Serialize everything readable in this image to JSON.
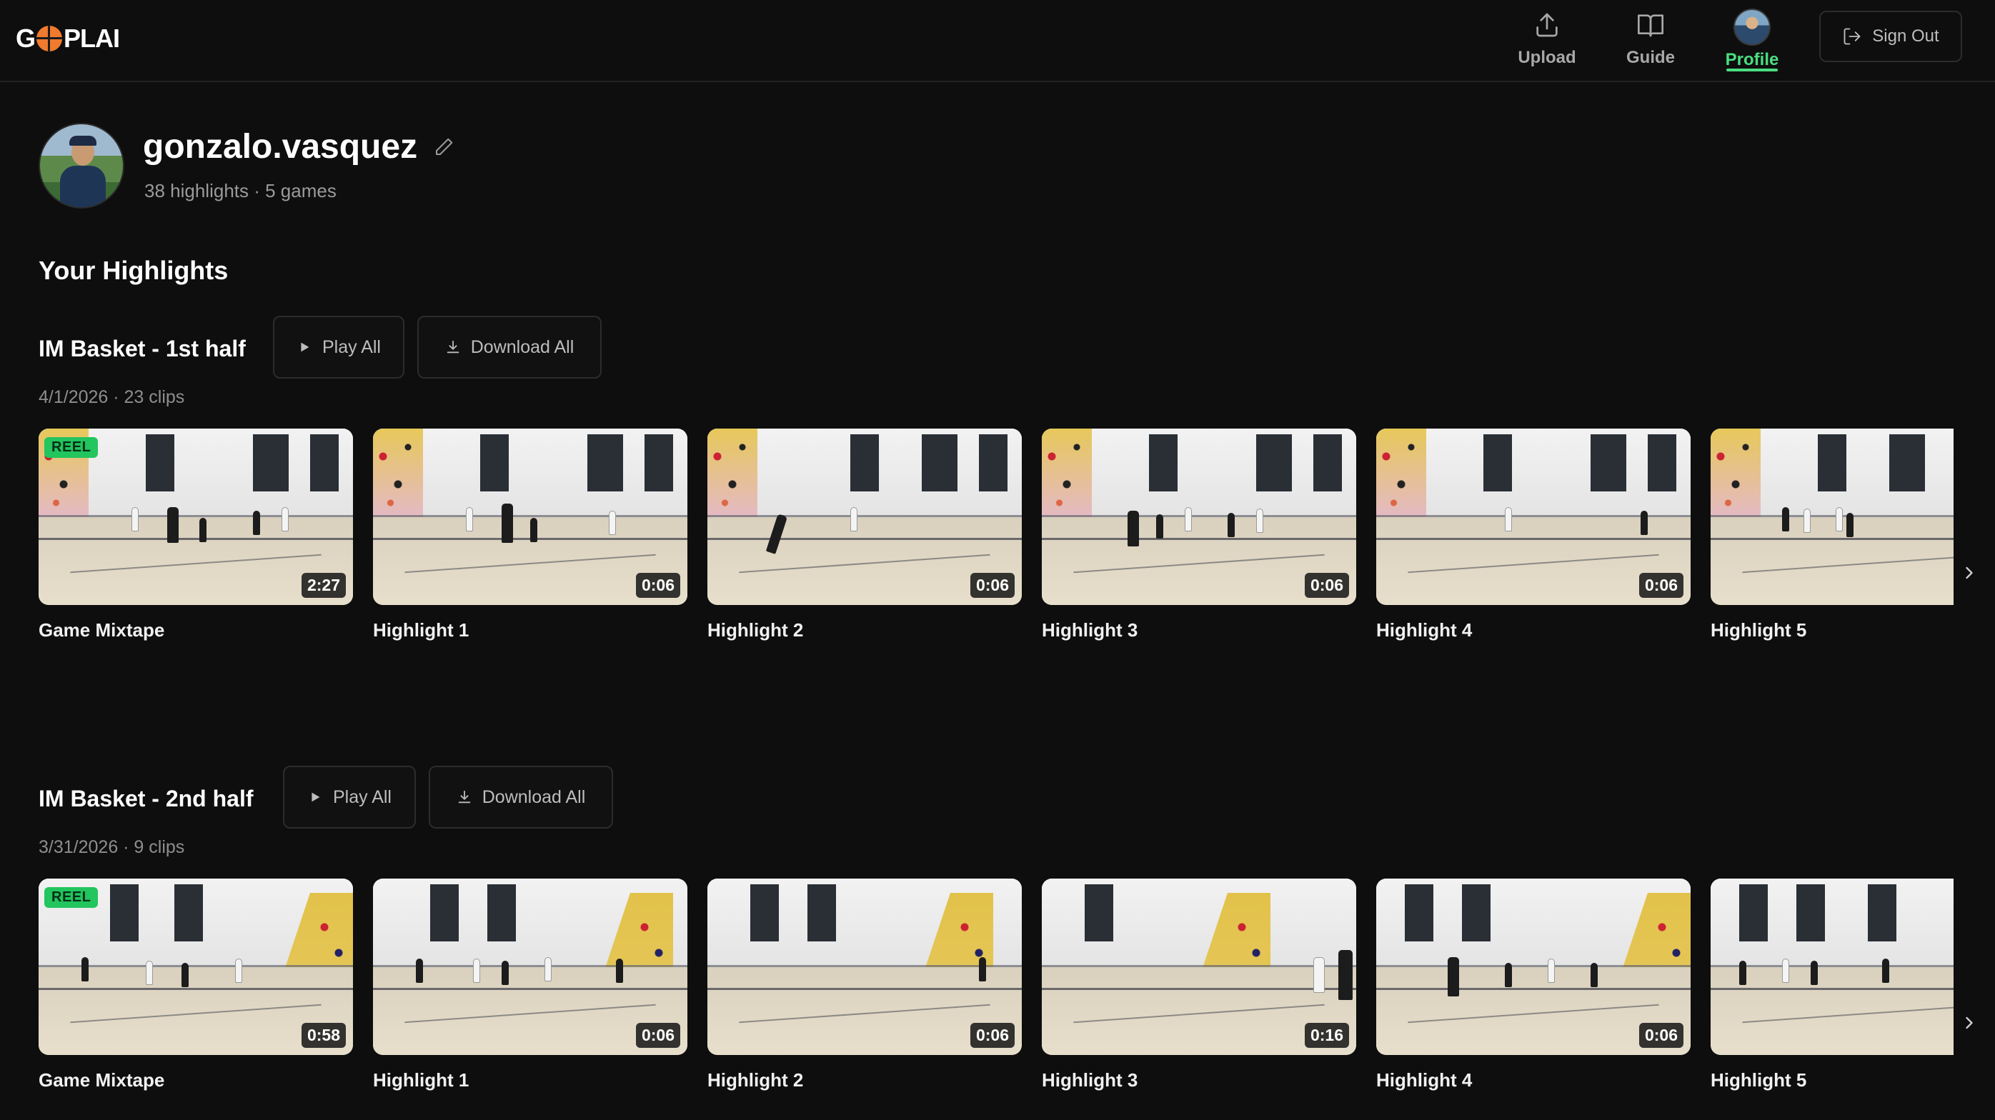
{
  "app": {
    "logo_left": "G",
    "logo_right": "PLAI"
  },
  "nav": {
    "upload": "Upload",
    "guide": "Guide",
    "profile": "Profile",
    "sign_out": "Sign Out"
  },
  "profile": {
    "username": "gonzalo.vasquez",
    "stats": "38 highlights · 5 games"
  },
  "section_title": "Your Highlights",
  "colors": {
    "accent": "#4ade80",
    "reel_badge": "#22c55e",
    "background": "#0e0e0e"
  },
  "games": [
    {
      "title": "IM Basket - 1st half",
      "play_all": "Play All",
      "download_all": "Download All",
      "meta": "4/1/2026 · 23 clips",
      "clips": [
        {
          "title": "Game Mixtape",
          "duration": "2:27",
          "badge": "REEL"
        },
        {
          "title": "Highlight 1",
          "duration": "0:06"
        },
        {
          "title": "Highlight 2",
          "duration": "0:06"
        },
        {
          "title": "Highlight 3",
          "duration": "0:06"
        },
        {
          "title": "Highlight 4",
          "duration": "0:06"
        },
        {
          "title": "Highlight 5",
          "duration": ""
        }
      ]
    },
    {
      "title": "IM Basket - 2nd half",
      "play_all": "Play All",
      "download_all": "Download All",
      "meta": "3/31/2026 · 9 clips",
      "clips": [
        {
          "title": "Game Mixtape",
          "duration": "0:58",
          "badge": "REEL"
        },
        {
          "title": "Highlight 1",
          "duration": "0:06"
        },
        {
          "title": "Highlight 2",
          "duration": "0:06"
        },
        {
          "title": "Highlight 3",
          "duration": "0:16"
        },
        {
          "title": "Highlight 4",
          "duration": "0:06"
        },
        {
          "title": "Highlight 5",
          "duration": ""
        }
      ]
    }
  ]
}
